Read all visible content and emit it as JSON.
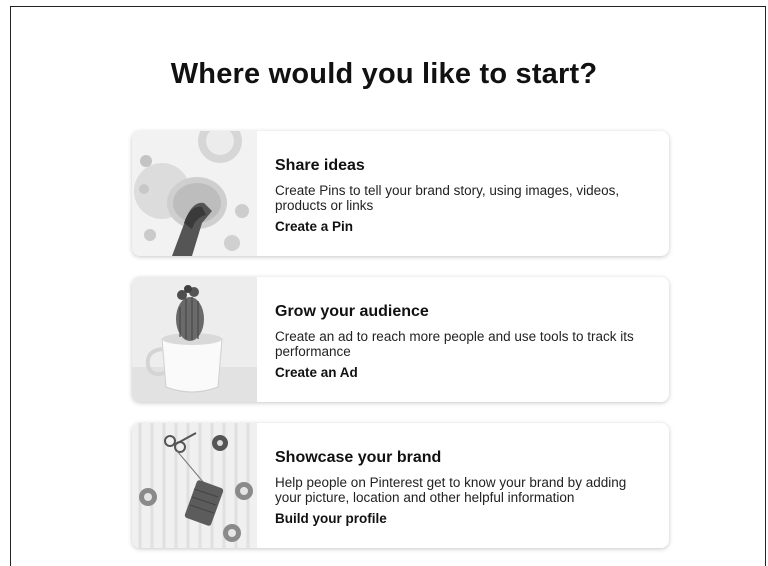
{
  "page": {
    "title": "Where would you like to start?"
  },
  "cards": [
    {
      "title": "Share ideas",
      "description": "Create Pins to tell your brand story, using images, videos, products or links",
      "link": "Create a Pin"
    },
    {
      "title": "Grow your audience",
      "description": "Create an ad to reach more people and use tools to track its performance",
      "link": "Create an Ad"
    },
    {
      "title": "Showcase your brand",
      "description": "Help people on Pinterest get to know your brand by adding your picture, location and other helpful information",
      "link": "Build your profile"
    }
  ],
  "icons": {
    "card_1_image": "crafting-hands-photo",
    "card_2_image": "cactus-in-cup-photo",
    "card_3_image": "twine-and-scissors-photo"
  }
}
